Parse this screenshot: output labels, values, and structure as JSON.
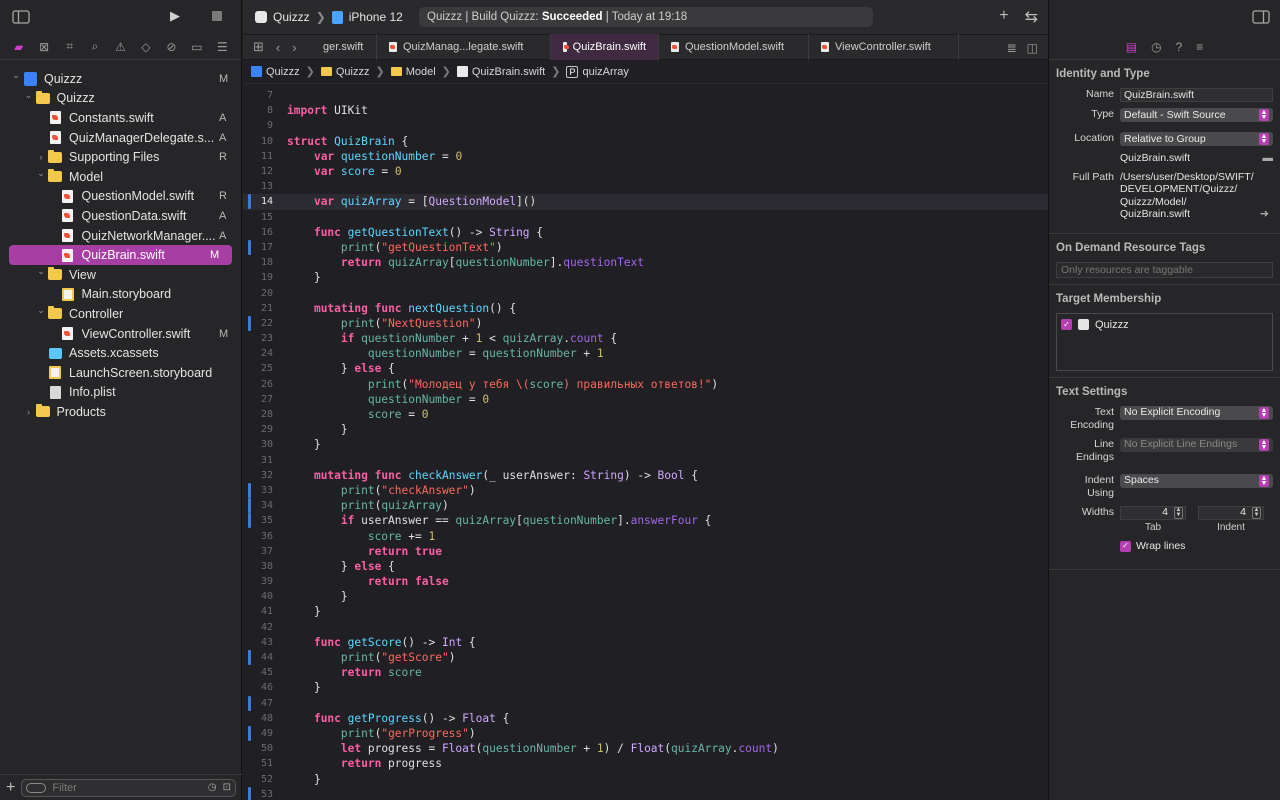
{
  "toolbar": {
    "scheme": "Quizzz",
    "device": "iPhone 12",
    "activity_prefix": "Quizzz | Build Quizzz:",
    "activity_status": "Succeeded",
    "activity_suffix": "| Today at 19:18"
  },
  "tabs": [
    {
      "label": "ger.swift",
      "active": false
    },
    {
      "label": "QuizManag...legate.swift",
      "active": false
    },
    {
      "label": "QuizBrain.swift",
      "active": true
    },
    {
      "label": "QuestionModel.swift",
      "active": false
    },
    {
      "label": "ViewController.swift",
      "active": false
    }
  ],
  "jumpbar": [
    "Quizzz",
    "Quizzz",
    "Model",
    "QuizBrain.swift",
    "quizArray"
  ],
  "navigator": {
    "filter_placeholder": "Filter",
    "items": [
      {
        "label": "Quizzz",
        "status": "M",
        "indent": 0,
        "kind": "project",
        "disclosure": "open"
      },
      {
        "label": "Quizzz",
        "status": "",
        "indent": 1,
        "kind": "folder",
        "disclosure": "open"
      },
      {
        "label": "Constants.swift",
        "status": "A",
        "indent": 2,
        "kind": "swift",
        "disclosure": ""
      },
      {
        "label": "QuizManagerDelegate.s...",
        "status": "A",
        "indent": 2,
        "kind": "swift",
        "disclosure": ""
      },
      {
        "label": "Supporting Files",
        "status": "R",
        "indent": 2,
        "kind": "folder",
        "disclosure": "closed"
      },
      {
        "label": "Model",
        "status": "",
        "indent": 2,
        "kind": "folder",
        "disclosure": "open"
      },
      {
        "label": "QuestionModel.swift",
        "status": "R",
        "indent": 3,
        "kind": "swift",
        "disclosure": ""
      },
      {
        "label": "QuestionData.swift",
        "status": "A",
        "indent": 3,
        "kind": "swift",
        "disclosure": ""
      },
      {
        "label": "QuizNetworkManager....",
        "status": "A",
        "indent": 3,
        "kind": "swift",
        "disclosure": ""
      },
      {
        "label": "QuizBrain.swift",
        "status": "M",
        "indent": 3,
        "kind": "swift",
        "disclosure": "",
        "selected": true
      },
      {
        "label": "View",
        "status": "",
        "indent": 2,
        "kind": "folder",
        "disclosure": "open"
      },
      {
        "label": "Main.storyboard",
        "status": "",
        "indent": 3,
        "kind": "storyboard",
        "disclosure": ""
      },
      {
        "label": "Controller",
        "status": "",
        "indent": 2,
        "kind": "folder",
        "disclosure": "open"
      },
      {
        "label": "ViewController.swift",
        "status": "M",
        "indent": 3,
        "kind": "swift",
        "disclosure": ""
      },
      {
        "label": "Assets.xcassets",
        "status": "",
        "indent": 2,
        "kind": "assets",
        "disclosure": ""
      },
      {
        "label": "LaunchScreen.storyboard",
        "status": "",
        "indent": 2,
        "kind": "storyboard",
        "disclosure": ""
      },
      {
        "label": "Info.plist",
        "status": "",
        "indent": 2,
        "kind": "plist",
        "disclosure": ""
      },
      {
        "label": "Products",
        "status": "",
        "indent": 1,
        "kind": "folder",
        "disclosure": "closed"
      }
    ]
  },
  "code": {
    "current_line": 14,
    "lines": [
      {
        "n": 7,
        "changed": false,
        "t": ""
      },
      {
        "n": 8,
        "changed": false,
        "t": "[[kw:import]] UIKit"
      },
      {
        "n": 9,
        "changed": false,
        "t": ""
      },
      {
        "n": 10,
        "changed": false,
        "t": "[[kw:struct]] [[decl:QuizBrain]] {"
      },
      {
        "n": 11,
        "changed": false,
        "t": "    [[kw:var]] [[decl:questionNumber]] = [[num:0]]"
      },
      {
        "n": 12,
        "changed": false,
        "t": "    [[kw:var]] [[decl:score]] = [[num:0]]"
      },
      {
        "n": 13,
        "changed": false,
        "t": ""
      },
      {
        "n": 14,
        "changed": true,
        "t": "    [[kw:var]] [[decl:quizArray]] = [[[ty:QuestionModel]]]()"
      },
      {
        "n": 15,
        "changed": false,
        "t": ""
      },
      {
        "n": 16,
        "changed": false,
        "t": "    [[kw:func]] [[decl:getQuestionText]]() -> [[ty:String]] {"
      },
      {
        "n": 17,
        "changed": true,
        "t": "        [[fn:print]]([[str:\"getQuestionText\"]])"
      },
      {
        "n": 18,
        "changed": false,
        "t": "        [[kw:return]] [[var:quizArray]][[[var:questionNumber]]].[[prop:questionText]]"
      },
      {
        "n": 19,
        "changed": false,
        "t": "    }"
      },
      {
        "n": 20,
        "changed": false,
        "t": ""
      },
      {
        "n": 21,
        "changed": false,
        "t": "    [[kw:mutating]] [[kw:func]] [[decl:nextQuestion]]() {"
      },
      {
        "n": 22,
        "changed": true,
        "t": "        [[fn:print]]([[str:\"NextQuestion\"]])"
      },
      {
        "n": 23,
        "changed": false,
        "t": "        [[kw:if]] [[var:questionNumber]] + [[num:1]] < [[var:quizArray]].[[prop:count]] {"
      },
      {
        "n": 24,
        "changed": false,
        "t": "            [[var:questionNumber]] = [[var:questionNumber]] + [[num:1]]"
      },
      {
        "n": 25,
        "changed": false,
        "t": "        } [[kw:else]] {"
      },
      {
        "n": 26,
        "changed": false,
        "t": "            [[fn:print]]([[str:\"Молодец у тебя \\(]][[var:score]][[str:) правильных ответов!\"]])"
      },
      {
        "n": 27,
        "changed": false,
        "t": "            [[var:questionNumber]] = [[num:0]]"
      },
      {
        "n": 28,
        "changed": false,
        "t": "            [[var:score]] = [[num:0]]"
      },
      {
        "n": 29,
        "changed": false,
        "t": "        }"
      },
      {
        "n": 30,
        "changed": false,
        "t": "    }"
      },
      {
        "n": 31,
        "changed": false,
        "t": ""
      },
      {
        "n": 32,
        "changed": false,
        "t": "    [[kw:mutating]] [[kw:func]] [[decl:checkAnswer]](_ userAnswer: [[ty:String]]) -> [[ty:Bool]] {"
      },
      {
        "n": 33,
        "changed": true,
        "t": "        [[fn:print]]([[str:\"checkAnswer\"]])"
      },
      {
        "n": 34,
        "changed": true,
        "t": "        [[fn:print]]([[var:quizArray]])"
      },
      {
        "n": 35,
        "changed": true,
        "t": "        [[kw:if]] userAnswer == [[var:quizArray]][[[var:questionNumber]]].[[prop:answerFour]] {"
      },
      {
        "n": 36,
        "changed": false,
        "t": "            [[var:score]] += [[num:1]]"
      },
      {
        "n": 37,
        "changed": false,
        "t": "            [[kw:return]] [[kw:true]]"
      },
      {
        "n": 38,
        "changed": false,
        "t": "        } [[kw:else]] {"
      },
      {
        "n": 39,
        "changed": false,
        "t": "            [[kw:return]] [[kw:false]]"
      },
      {
        "n": 40,
        "changed": false,
        "t": "        }"
      },
      {
        "n": 41,
        "changed": false,
        "t": "    }"
      },
      {
        "n": 42,
        "changed": false,
        "t": ""
      },
      {
        "n": 43,
        "changed": false,
        "t": "    [[kw:func]] [[decl:getScore]]() -> [[ty:Int]] {"
      },
      {
        "n": 44,
        "changed": true,
        "t": "        [[fn:print]]([[str:\"getScore\"]])"
      },
      {
        "n": 45,
        "changed": false,
        "t": "        [[kw:return]] [[var:score]]"
      },
      {
        "n": 46,
        "changed": false,
        "t": "    }"
      },
      {
        "n": 47,
        "changed": true,
        "t": ""
      },
      {
        "n": 48,
        "changed": false,
        "t": "    [[kw:func]] [[decl:getProgress]]() -> [[ty:Float]] {"
      },
      {
        "n": 49,
        "changed": true,
        "t": "        [[fn:print]]([[str:\"gerProgress\"]])"
      },
      {
        "n": 50,
        "changed": false,
        "t": "        [[kw:let]] progress = [[ty:Float]]([[var:questionNumber]] + [[num:1]]) / [[ty:Float]]([[var:quizArray]].[[prop:count]])"
      },
      {
        "n": 51,
        "changed": false,
        "t": "        [[kw:return]] progress"
      },
      {
        "n": 52,
        "changed": false,
        "t": "    }"
      },
      {
        "n": 53,
        "changed": true,
        "t": ""
      }
    ]
  },
  "inspector": {
    "identity_title": "Identity and Type",
    "name_label": "Name",
    "name_value": "QuizBrain.swift",
    "type_label": "Type",
    "type_value": "Default - Swift Source",
    "location_label": "Location",
    "location_value": "Relative to Group",
    "location_file": "QuizBrain.swift",
    "fullpath_label": "Full Path",
    "fullpath_lines": [
      "/Users/user/Desktop/SWIFT/",
      "DEVELOPMENT/Quizzz/",
      "Quizzz/Model/",
      "QuizBrain.swift"
    ],
    "tags_title": "On Demand Resource Tags",
    "tags_hint": "Only resources are taggable",
    "membership_title": "Target Membership",
    "membership_target": "Quizzz",
    "text_settings_title": "Text Settings",
    "encoding_label": "Text Encoding",
    "encoding_value": "No Explicit Encoding",
    "line_endings_label": "Line Endings",
    "line_endings_value": "No Explicit Line Endings",
    "indent_using_label": "Indent Using",
    "indent_using_value": "Spaces",
    "widths_label": "Widths",
    "tab_width": "4",
    "indent_width": "4",
    "tab_caption": "Tab",
    "indent_caption": "Indent",
    "wrap_label": "Wrap lines"
  },
  "colors": {
    "accent": "#a63ea3",
    "change_bar": "#3d7bd9",
    "keyword": "#fc5fa3",
    "string": "#fc6a5d",
    "number": "#d0bf69"
  }
}
